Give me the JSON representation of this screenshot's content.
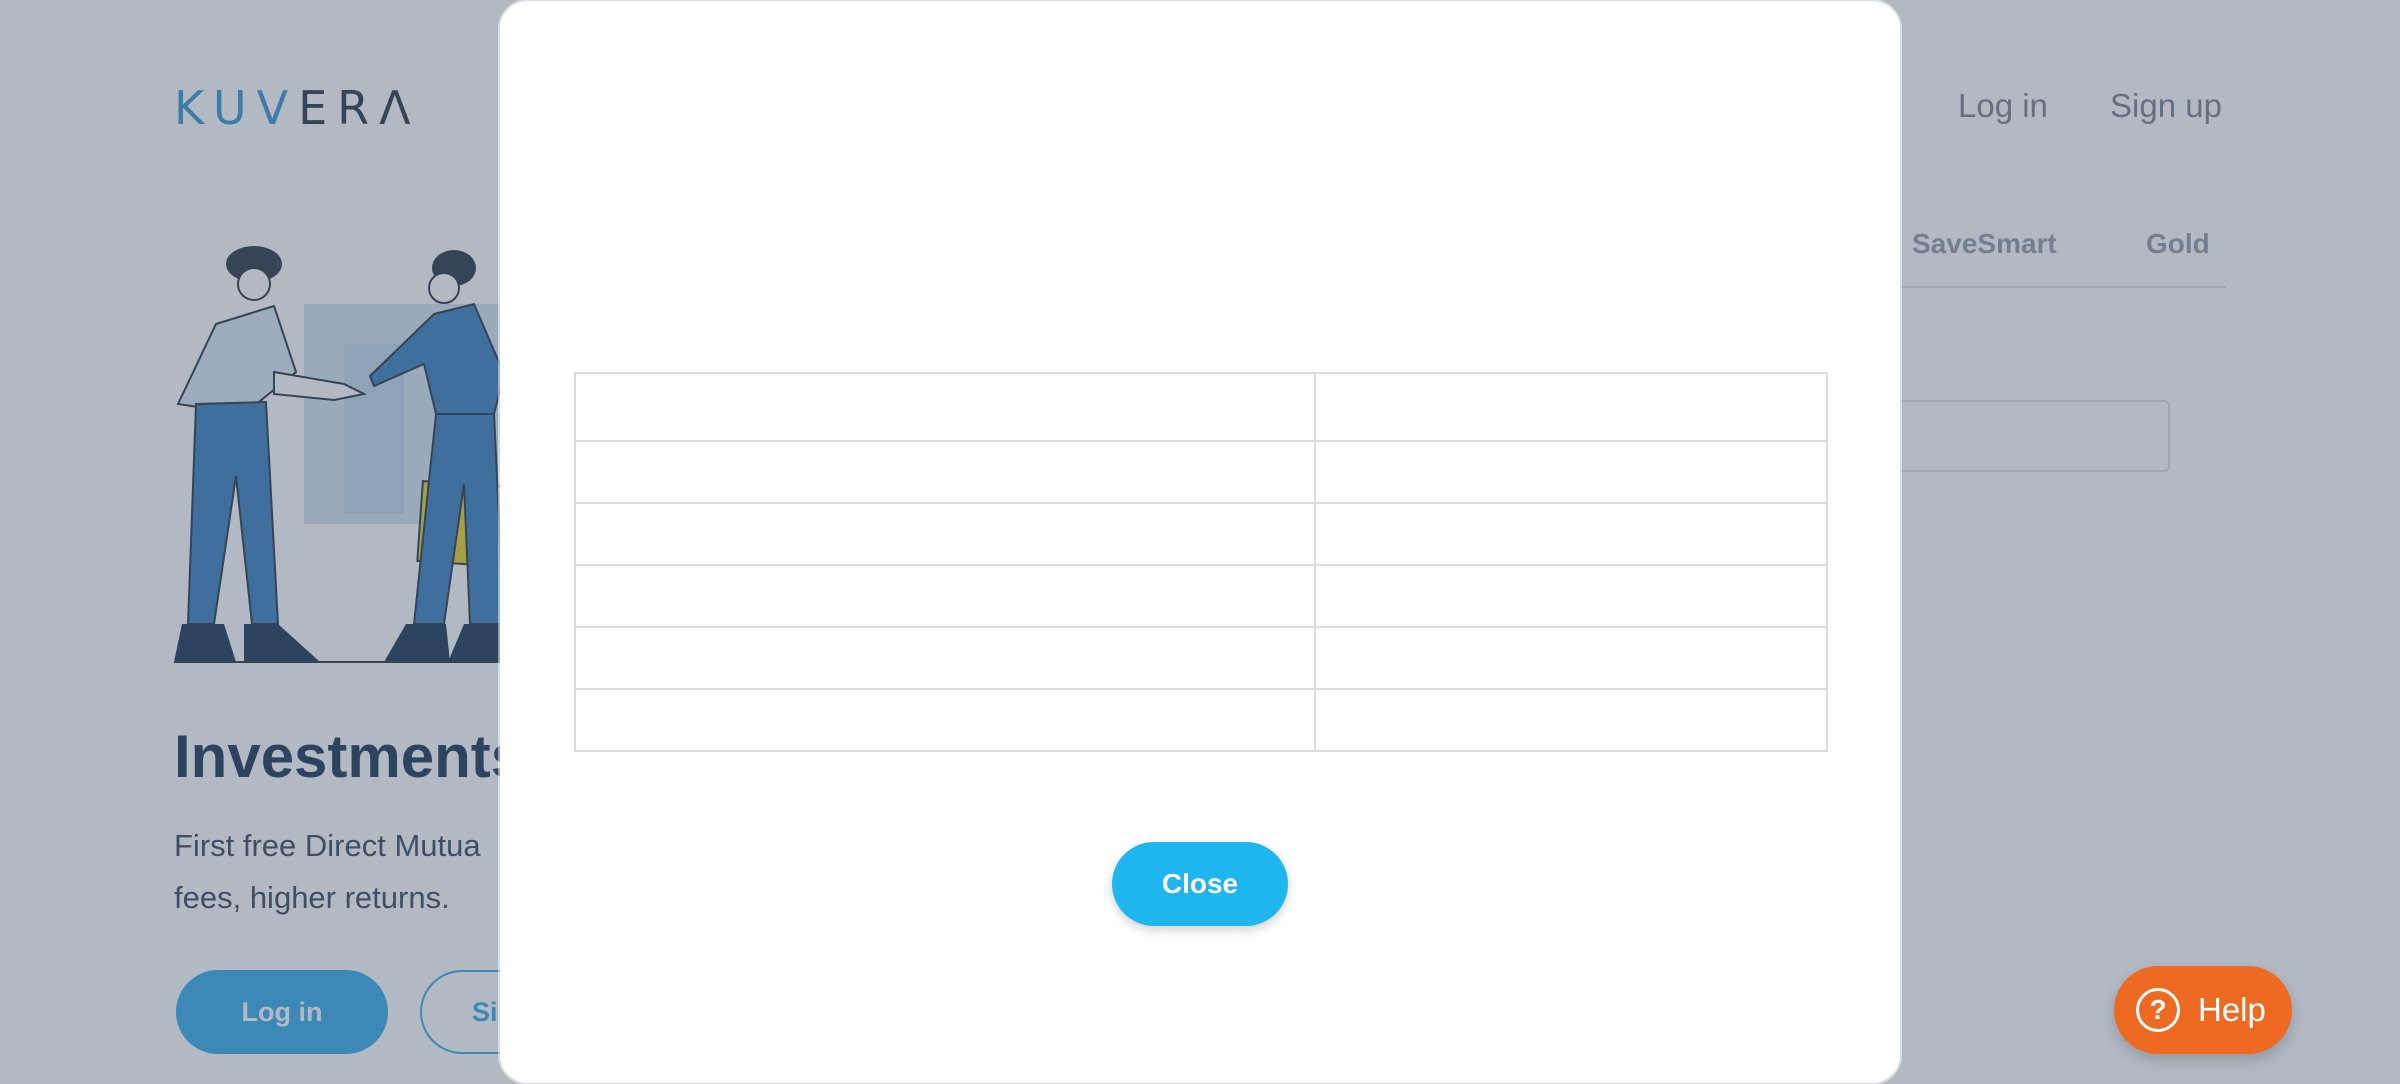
{
  "header": {
    "logo_left": "KUV",
    "logo_right": "ERΛ",
    "login_link": "Log in",
    "signup_link": "Sign up"
  },
  "tabs": [
    {
      "label": "SaveSmart"
    },
    {
      "label": "Gold"
    }
  ],
  "hero": {
    "headline": "Investments",
    "subtext_line1": "First free Direct Mutua",
    "subtext_line2": "fees, higher returns.",
    "login_button": "Log in",
    "signup_button": "Si"
  },
  "modal": {
    "table_rows": [
      [
        "",
        ""
      ],
      [
        "",
        ""
      ],
      [
        "",
        ""
      ],
      [
        "",
        ""
      ],
      [
        "",
        ""
      ],
      [
        "",
        ""
      ]
    ],
    "close_button": "Close"
  },
  "help": {
    "icon": "question-circle-icon",
    "label": "Help"
  },
  "colors": {
    "brand_blue": "#29a7e8",
    "close_blue": "#1fb6f0",
    "help_orange": "#ee6a22",
    "headline_navy": "#0e2a4d"
  }
}
